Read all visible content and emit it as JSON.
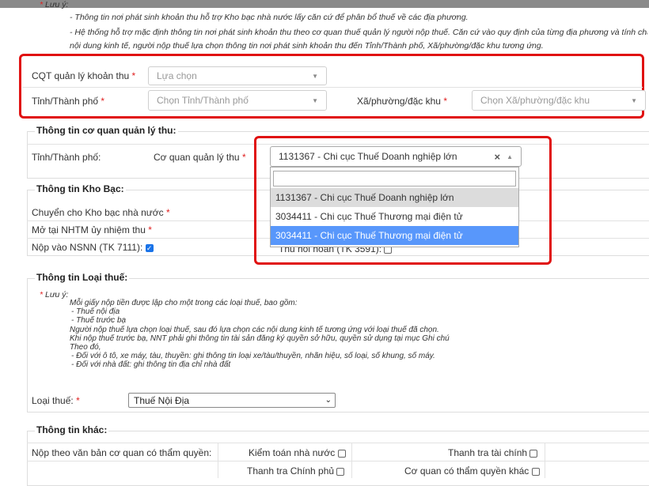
{
  "top_note": {
    "heading": "Lưu ý:",
    "line1": "- Thông tin nơi phát sinh khoản thu hỗ trợ Kho bạc nhà nước lấy căn cứ để phân bổ thuế về các địa phương.",
    "line2": "- Hệ thống hỗ trợ mặc định thông tin nơi phát sinh khoản thu theo cơ quan thuế quản lý người nộp thuế. Căn cứ vào quy định của từng địa phương và tính chất",
    "line3": "nội dung kinh tế, người nộp thuế lựa chọn thông tin nơi phát sinh khoản thu đến Tỉnh/Thành phố, Xã/phường/đặc khu tương ứng."
  },
  "revenue_place": {
    "cqt_label": "CQT quản lý khoản thu",
    "cqt_placeholder": "Lựa chọn",
    "province_label": "Tỉnh/Thành phố",
    "province_placeholder": "Chọn Tỉnh/Thành phố",
    "ward_label": "Xã/phường/đặc khu",
    "ward_placeholder": "Chọn Xã/phường/đặc khu",
    "required_mark": "*"
  },
  "agency": {
    "title": "Thông tin cơ quan quản lý thu:",
    "province_label": "Tỉnh/Thành phố:",
    "agency_label": "Cơ quan quản lý thu",
    "selected": "1131367 - Chi cục Thuế Doanh nghiệp lớn",
    "clear_symbol": "×",
    "options": [
      "1131367 - Chi cục Thuế Doanh nghiệp lớn",
      "3034411 - Chi cục Thuế Thương mại điện tử",
      "3034411 - Chi cục Thuế Thương mại điện tử"
    ]
  },
  "treasury": {
    "title": "Thông tin Kho Bạc:",
    "transfer_label": "Chuyển cho Kho bạc nhà nước",
    "bank_label": "Mở tại NHTM ủy nhiệm thu",
    "nsnn_label": "Nộp vào NSNN (TK 7111):",
    "refund_label": "Thu hồi hoàn (TK 3591):"
  },
  "tax_type": {
    "title": "Thông tin Loại thuế:",
    "note_heading": "Lưu ý:",
    "note_lines": [
      "Mỗi giấy nộp tiền được lập cho một trong các loại thuế, bao gồm:",
      "- Thuế nội địa",
      "- Thuế trước bạ",
      "Người nộp thuế lựa chọn loại thuế, sau đó lựa chọn các nội dung kinh tế tương ứng với loại thuế đã chọn.",
      "Khi nộp thuế trước bạ, NNT phải ghi thông tin tài sản đăng ký quyền sở hữu, quyền sử dụng tại mục Ghi chú",
      "Theo đó,",
      "- Đối với ô tô, xe máy, tàu, thuyền: ghi thông tin loại xe/tàu/thuyền, nhãn hiệu, số loại, số khung, số máy.",
      "- Đối với nhà đất: ghi thông tin địa chỉ nhà đất"
    ],
    "type_label": "Loại thuế:",
    "type_value": "Thuế Nội Địa"
  },
  "other": {
    "title": "Thông tin khác:",
    "doc_label": "Nộp theo văn bản cơ quan có thẩm quyền:",
    "audit_label": "Kiểm toán nhà nước",
    "finance_label": "Thanh tra tài chính",
    "gov_label": "Thanh tra Chính phủ",
    "competent_label": "Cơ quan có thẩm quyền khác"
  },
  "colors": {
    "highlight_box": "#e01010",
    "selected_option": "#5897fb",
    "hover_option": "#dcdcdc"
  }
}
